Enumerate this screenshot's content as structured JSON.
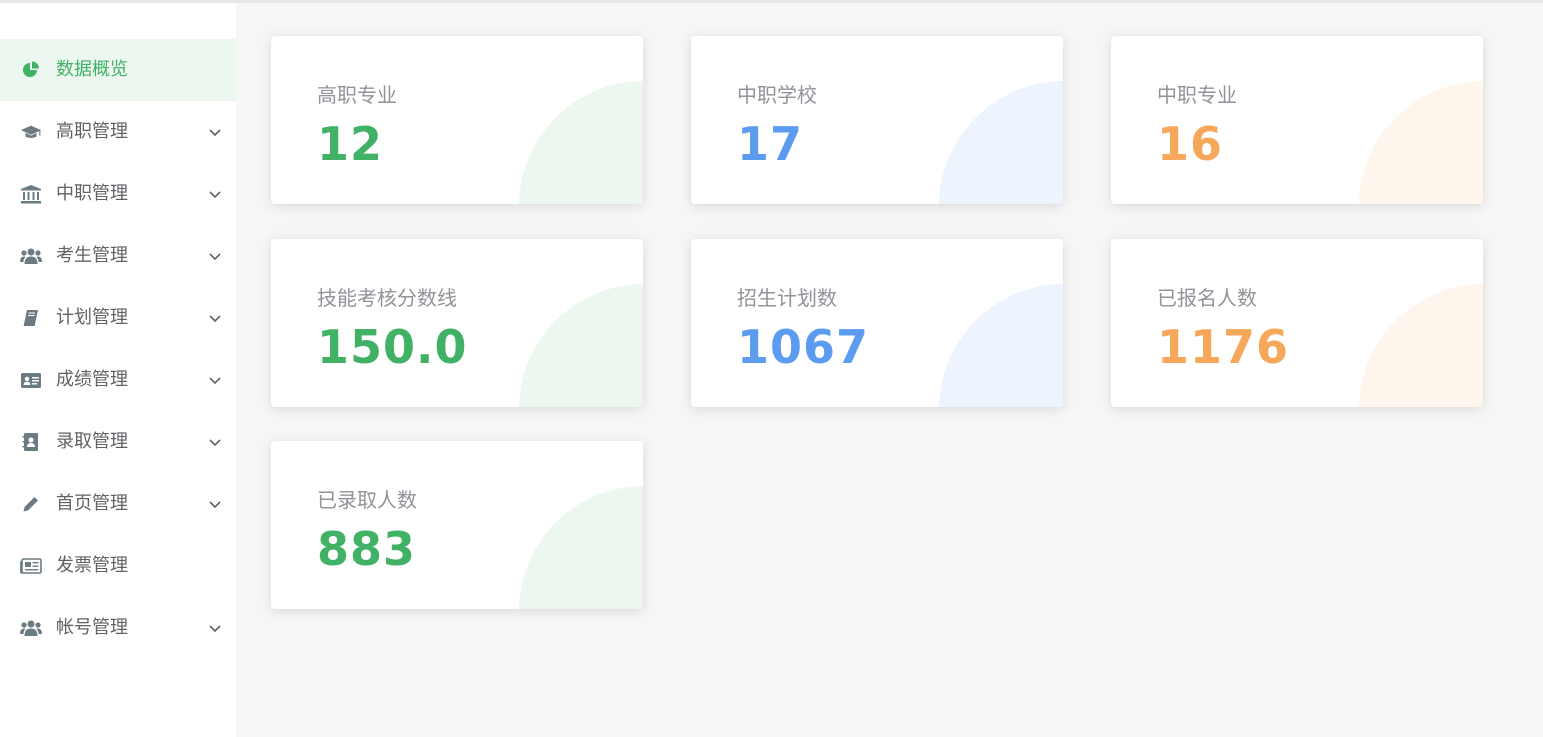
{
  "colors": {
    "green": "#41b166",
    "blue": "#5b9bf0",
    "orange": "#f6a85a",
    "green_bg": "#ecf7ef",
    "blue_bg": "#edf4fe",
    "orange_bg": "#fef5ec"
  },
  "sidebar": {
    "items": [
      {
        "label": "数据概览",
        "icon": "pie-chart-icon",
        "active": true,
        "has_submenu": false
      },
      {
        "label": "高职管理",
        "icon": "graduation-cap-icon",
        "active": false,
        "has_submenu": true
      },
      {
        "label": "中职管理",
        "icon": "bank-icon",
        "active": false,
        "has_submenu": true
      },
      {
        "label": "考生管理",
        "icon": "users-icon",
        "active": false,
        "has_submenu": true
      },
      {
        "label": "计划管理",
        "icon": "book-icon",
        "active": false,
        "has_submenu": true
      },
      {
        "label": "成绩管理",
        "icon": "id-card-icon",
        "active": false,
        "has_submenu": true
      },
      {
        "label": "录取管理",
        "icon": "contact-book-icon",
        "active": false,
        "has_submenu": true
      },
      {
        "label": "首页管理",
        "icon": "pencil-icon",
        "active": false,
        "has_submenu": true
      },
      {
        "label": "发票管理",
        "icon": "newspaper-icon",
        "active": false,
        "has_submenu": false
      },
      {
        "label": "帐号管理",
        "icon": "users-icon",
        "active": false,
        "has_submenu": true
      }
    ]
  },
  "stats": [
    {
      "title": "高职专业",
      "value": "12",
      "color": "green"
    },
    {
      "title": "中职学校",
      "value": "17",
      "color": "blue"
    },
    {
      "title": "中职专业",
      "value": "16",
      "color": "orange"
    },
    {
      "title": "技能考核分数线",
      "value": "150.0",
      "color": "green"
    },
    {
      "title": "招生计划数",
      "value": "1067",
      "color": "blue"
    },
    {
      "title": "已报名人数",
      "value": "1176",
      "color": "orange"
    },
    {
      "title": "已录取人数",
      "value": "883",
      "color": "green"
    }
  ]
}
